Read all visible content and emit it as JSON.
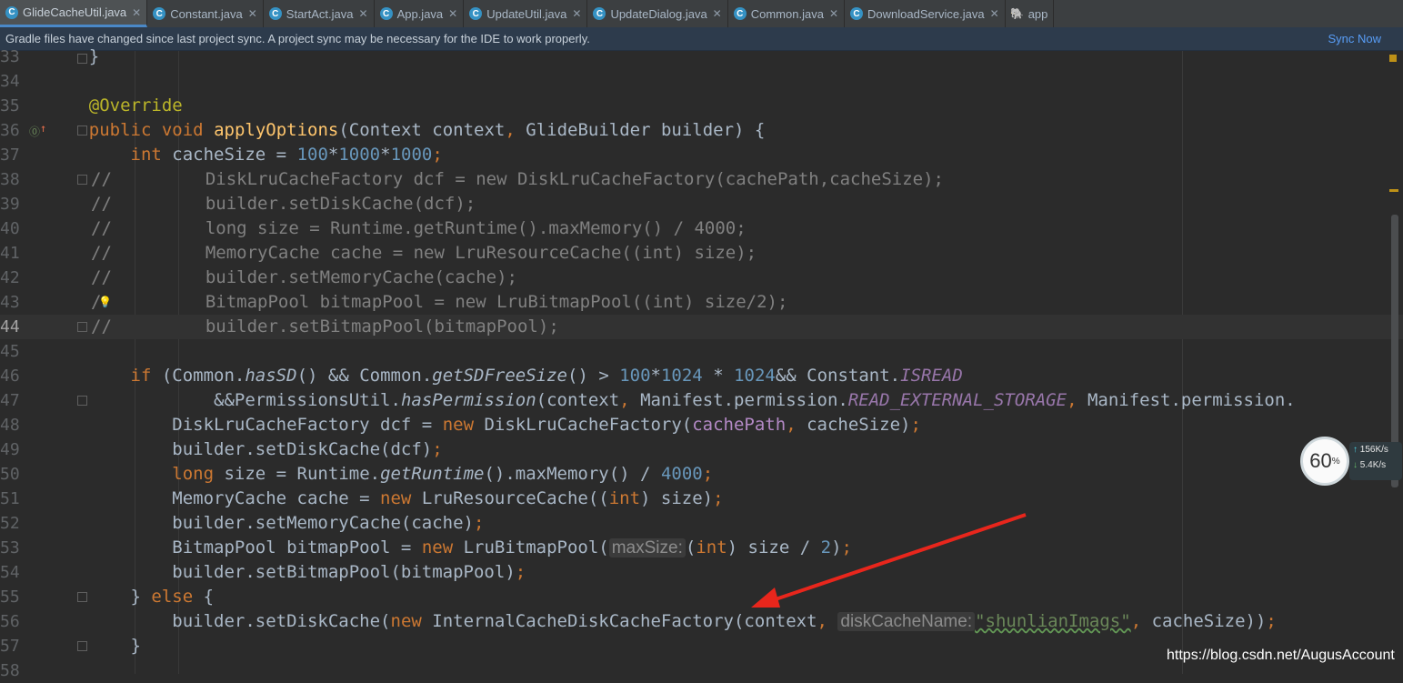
{
  "tabs": [
    {
      "label": "GlideCacheUtil.java",
      "active": true
    },
    {
      "label": "Constant.java",
      "active": false
    },
    {
      "label": "StartAct.java",
      "active": false
    },
    {
      "label": "App.java",
      "active": false
    },
    {
      "label": "UpdateUtil.java",
      "active": false
    },
    {
      "label": "UpdateDialog.java",
      "active": false
    },
    {
      "label": "Common.java",
      "active": false
    },
    {
      "label": "DownloadService.java",
      "active": false
    },
    {
      "label": "app",
      "active": false
    }
  ],
  "banner": {
    "message": "Gradle files have changed since last project sync. A project sync may be necessary for the IDE to work properly.",
    "action": "Sync Now"
  },
  "line_numbers": [
    "33",
    "34",
    "35",
    "36",
    "37",
    "38",
    "39",
    "40",
    "41",
    "42",
    "43",
    "44",
    "45",
    "46",
    "47",
    "48",
    "49",
    "50",
    "51",
    "52",
    "53",
    "54",
    "55",
    "56",
    "57",
    "58"
  ],
  "current_line": "44",
  "monitor": {
    "percent": "60",
    "percent_unit": "%",
    "upload": "156",
    "upload_unit": "K/s",
    "download": "5.4",
    "download_unit": "K/s"
  },
  "watermark": "https://blog.csdn.net/AugusAccount",
  "colors": {
    "background": "#2b2b2b",
    "keyword": "#cc7832",
    "annotation": "#bbb529",
    "method": "#ffc66d",
    "number": "#6897bb",
    "comment": "#808080",
    "field": "#9876aa",
    "string": "#6a8759",
    "arrow": "#e8261c"
  }
}
